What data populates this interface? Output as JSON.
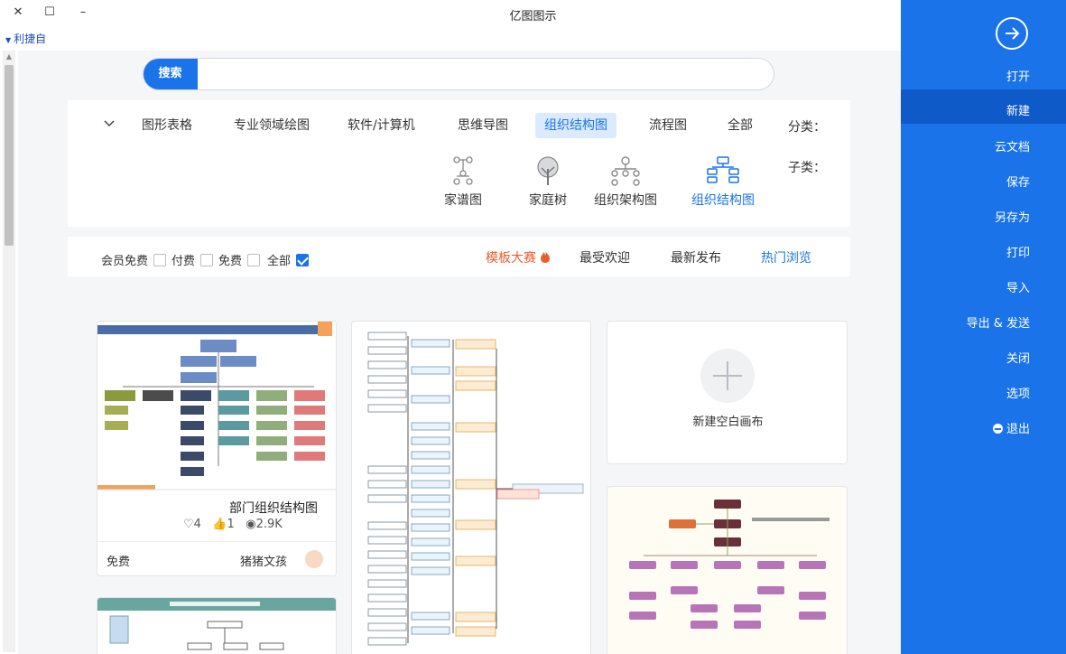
{
  "window": {
    "title": "亿图图示",
    "close_glyph": "✕",
    "maximize_glyph": "☐",
    "minimize_glyph": "–"
  },
  "menubar": {
    "label": "利捷自"
  },
  "search": {
    "button_label": "搜索",
    "placeholder": ""
  },
  "category": {
    "label": "分类：",
    "items": [
      "全部",
      "流程图",
      "组织结构图",
      "思维导图",
      "软件/计算机",
      "专业领域绘图",
      "图形表格"
    ],
    "active": "组织结构图"
  },
  "subcategory": {
    "label": "子类：",
    "items": [
      "组织结构图",
      "组织架构图",
      "家庭树",
      "家谱图"
    ],
    "active": "组织结构图"
  },
  "sort": {
    "items": [
      "热门浏览",
      "最新发布",
      "最受欢迎",
      "模板大赛"
    ],
    "active": "热门浏览",
    "hot": "模板大赛"
  },
  "price_filter": {
    "items": [
      {
        "label": "全部",
        "checked": true
      },
      {
        "label": "免费",
        "checked": false
      },
      {
        "label": "付费",
        "checked": false
      },
      {
        "label": "会员免费",
        "checked": false
      }
    ]
  },
  "new_card": {
    "label": "新建空白画布"
  },
  "template_card": {
    "title": "部门组织结构图",
    "views": "2.9K",
    "likes": "1",
    "favorites": "4",
    "author": "猪猪文孩",
    "price": "免费"
  },
  "sidebar": {
    "items": [
      "打开",
      "新建",
      "云文档",
      "保存",
      "另存为",
      "打印",
      "导入",
      "导出 & 发送",
      "关闭",
      "选项",
      "退出"
    ],
    "active": "新建"
  },
  "colors": {
    "accent": "#1a73e8",
    "sidebar_active": "#0f5ac9",
    "hot": "#ef5b2b",
    "active_tab_bg": "#dbeafe"
  }
}
